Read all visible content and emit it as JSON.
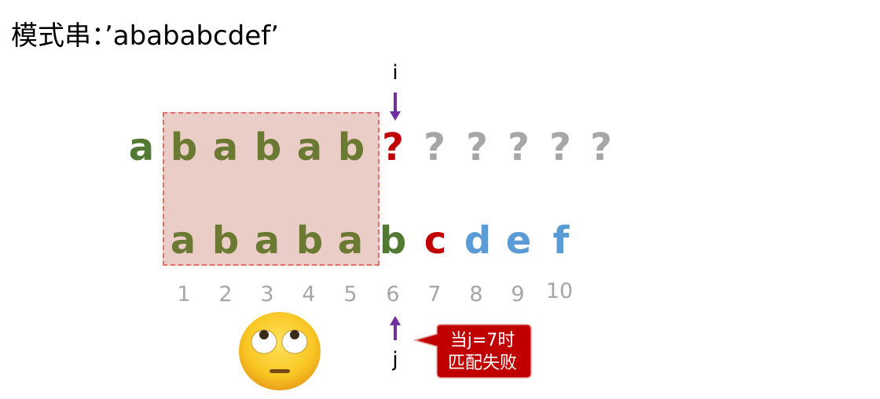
{
  "title": "模式串：’abababcdef’",
  "text_row": [
    {
      "ch": "a",
      "color": "green"
    },
    {
      "ch": "b",
      "color": "olive"
    },
    {
      "ch": "a",
      "color": "olive"
    },
    {
      "ch": "b",
      "color": "olive"
    },
    {
      "ch": "a",
      "color": "olive"
    },
    {
      "ch": "b",
      "color": "olive"
    },
    {
      "ch": "?",
      "color": "red"
    },
    {
      "ch": "?",
      "color": "gray"
    },
    {
      "ch": "?",
      "color": "gray"
    },
    {
      "ch": "?",
      "color": "gray"
    },
    {
      "ch": "?",
      "color": "gray"
    },
    {
      "ch": "?",
      "color": "gray"
    }
  ],
  "pattern_row": [
    {
      "ch": "a",
      "color": "olive"
    },
    {
      "ch": "b",
      "color": "olive"
    },
    {
      "ch": "a",
      "color": "olive"
    },
    {
      "ch": "b",
      "color": "olive"
    },
    {
      "ch": "a",
      "color": "olive"
    },
    {
      "ch": "b",
      "color": "green"
    },
    {
      "ch": "c",
      "color": "red"
    },
    {
      "ch": "d",
      "color": "blue"
    },
    {
      "ch": "e",
      "color": "blue"
    },
    {
      "ch": "f",
      "color": "blue"
    }
  ],
  "indices": [
    "1",
    "2",
    "3",
    "4",
    "5",
    "6",
    "7",
    "8",
    "9",
    "10"
  ],
  "pointer_i": "i",
  "pointer_j": "j",
  "callout": {
    "line1": "当j=7时",
    "line2": "匹配失败"
  },
  "colors": {
    "green": "#527a33",
    "olive": "#6b7a32",
    "red": "#c00000",
    "gray": "#a6a6a6",
    "blue": "#5b9bd5",
    "arrow": "#7030a0",
    "callout_fill": "#c00000",
    "match_fill": "#ebcdc7",
    "match_border": "#e0706a"
  },
  "emoji": "eye-roll-face"
}
